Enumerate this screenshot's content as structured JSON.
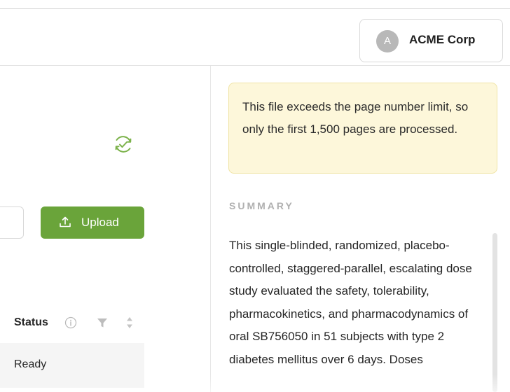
{
  "header": {
    "account": {
      "initial": "A",
      "name": "ACME Corp"
    }
  },
  "left_panel": {
    "sync_icon": "sync-check-icon",
    "upload_button": {
      "icon": "upload-icon",
      "label": "Upload"
    },
    "table": {
      "columns": [
        {
          "label": "Status",
          "icons": [
            "info-icon",
            "filter-icon",
            "sort-icon"
          ]
        }
      ],
      "rows": [
        {
          "status": "Ready"
        }
      ]
    }
  },
  "right_panel": {
    "warning": "This file exceeds the page number limit, so only the first 1,500 pages are processed.",
    "summary_heading": "SUMMARY",
    "summary_text": "This single-blinded, randomized, placebo-controlled, staggered-parallel, escalating dose study evaluated the safety, tolerability, pharmacokinetics, and pharmacodynamics of oral SB756050 in 51 subjects with type 2 diabetes mellitus over 6 days. Doses"
  },
  "colors": {
    "upload_button": "#6aa43a",
    "warning_background": "#fdf7da",
    "sync_icon": "#7bb24a",
    "selected_row": "#f5f5f5"
  }
}
